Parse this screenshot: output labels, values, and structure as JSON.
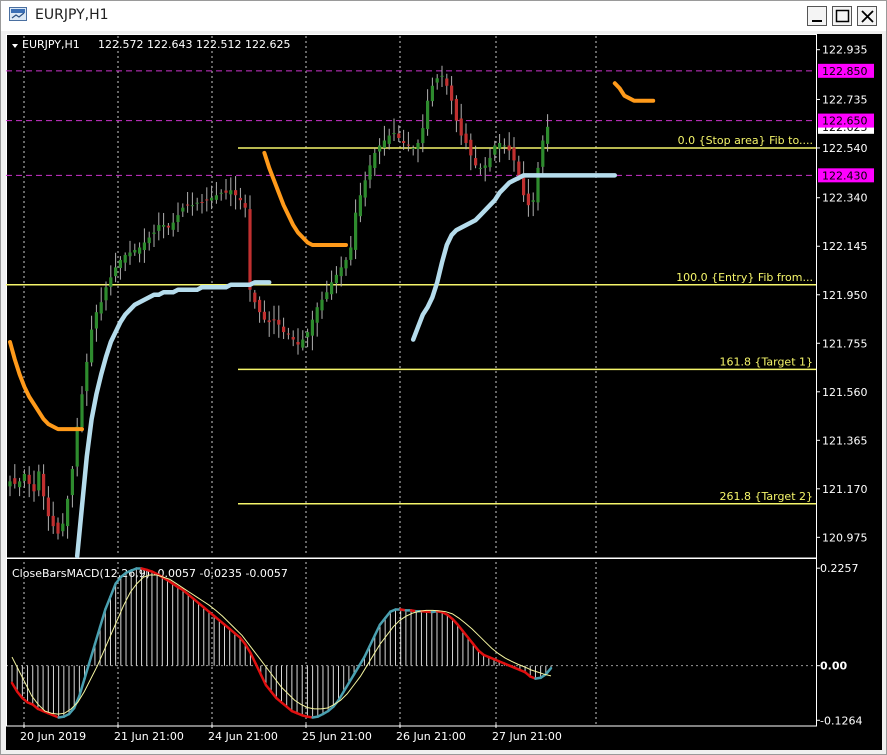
{
  "window": {
    "title": "EURJPY,H1",
    "controls": [
      "minimize",
      "maximize",
      "close"
    ]
  },
  "chart_header": {
    "symbol": "EURJPY,H1",
    "ohlc": "122.572 122.643 122.512 122.625"
  },
  "indicator_header": {
    "label": "CloseBarsMACD(12,26,9) -0.0057 -0.0235 -0.0057"
  },
  "colors": {
    "background": "#000000",
    "grid": "#ffffff",
    "bull_candle": "#2e8b2e",
    "bear_candle": "#c03030",
    "orange_line": "#ff9a1a",
    "lightblue_line": "#b5dcec",
    "fib_line": "#f5f56a",
    "magenta_line": "#cc33cc",
    "price_tag_bg": "#ff00ff",
    "macd_up": "#4aa0b0",
    "macd_down": "#e01010",
    "signal": "#f5f5a0"
  },
  "chart_data": [
    {
      "type": "candlestick",
      "title": "",
      "xlabel": "",
      "ylabel": "",
      "x_tick_labels": [
        "20 Jun 2019",
        "21 Jun 21:00",
        "24 Jun 21:00",
        "25 Jun 21:00",
        "26 Jun 21:00",
        "27 Jun 21:00"
      ],
      "y_tick_labels": [
        "122.935",
        "122.735",
        "122.540",
        "122.340",
        "122.145",
        "121.950",
        "121.755",
        "121.560",
        "121.365",
        "121.170",
        "120.975"
      ],
      "ylim": [
        120.9,
        122.99
      ],
      "grid": true,
      "price_levels": [
        {
          "label": "122.850",
          "value": 122.85,
          "style": "dashed-magenta"
        },
        {
          "label": "122.650",
          "value": 122.65,
          "style": "dashed-magenta"
        },
        {
          "label": "122.625",
          "value": 122.625,
          "style": "current-price"
        },
        {
          "label": "122.430",
          "value": 122.43,
          "style": "dashed-magenta"
        }
      ],
      "fib_levels": [
        {
          "label": "0.0  {Stop area} Fib to....",
          "value": 122.54,
          "full_width": true
        },
        {
          "label": "100.0 {Entry} Fib from...",
          "value": 121.99,
          "full_width": true
        },
        {
          "label": "161.8  {Target 1}",
          "value": 121.65,
          "full_width": false
        },
        {
          "label": "261.8   {Target  2}",
          "value": 121.11,
          "full_width": false
        }
      ],
      "close_series": [
        121.2,
        121.19,
        121.2,
        121.23,
        121.19,
        121.16,
        121.24,
        121.14,
        121.06,
        121.02,
        120.99,
        121.03,
        121.13,
        121.25,
        121.42,
        121.55,
        121.68,
        121.81,
        121.88,
        121.92,
        121.98,
        122.02,
        122.06,
        122.09,
        122.11,
        122.12,
        122.13,
        122.14,
        122.16,
        122.18,
        122.2,
        122.23,
        122.23,
        122.22,
        122.24,
        122.27,
        122.3,
        122.31,
        122.31,
        122.32,
        122.32,
        122.33,
        122.34,
        122.35,
        122.36,
        122.36,
        122.37,
        122.35,
        122.33,
        122.3,
        121.97,
        121.92,
        121.88,
        121.85,
        121.84,
        121.85,
        121.83,
        121.8,
        121.79,
        121.77,
        121.75,
        121.77,
        121.8,
        121.85,
        121.9,
        121.93,
        121.96,
        122.0,
        122.03,
        122.06,
        122.09,
        122.14,
        122.28,
        122.35,
        122.41,
        122.47,
        122.52,
        122.55,
        122.57,
        122.59,
        122.6,
        122.58,
        122.56,
        122.55,
        122.54,
        122.56,
        122.62,
        122.73,
        122.79,
        122.82,
        122.83,
        122.79,
        122.73,
        122.65,
        122.59,
        122.56,
        122.51,
        122.47,
        122.46,
        122.47,
        122.5,
        122.55,
        122.56,
        122.55,
        122.53,
        122.49,
        122.43,
        122.35,
        122.31,
        122.33,
        122.46,
        122.57,
        122.625
      ],
      "orange_line_segments": [
        {
          "x_index_range": [
            0,
            15
          ],
          "values": [
            121.76,
            121.69,
            121.63,
            121.58,
            121.54,
            121.51,
            121.48,
            121.45,
            121.43,
            121.42,
            121.41,
            121.41,
            121.41,
            121.41,
            121.41,
            121.41
          ]
        },
        {
          "x_index_range": [
            53,
            70
          ],
          "values": [
            122.52,
            122.46,
            122.41,
            122.36,
            122.31,
            122.27,
            122.23,
            122.2,
            122.18,
            122.16,
            122.15,
            122.15,
            122.15,
            122.15,
            122.15,
            122.15,
            122.15,
            122.15
          ]
        },
        {
          "x_index_range": [
            126,
            134
          ],
          "values": [
            122.8,
            122.78,
            122.75,
            122.74,
            122.73,
            122.73,
            122.73,
            122.73,
            122.73
          ]
        }
      ],
      "lightblue_line_segments": [
        {
          "x_index_range": [
            14,
            54
          ],
          "values": [
            120.9,
            121.1,
            121.3,
            121.45,
            121.55,
            121.63,
            121.7,
            121.76,
            121.8,
            121.84,
            121.87,
            121.89,
            121.91,
            121.92,
            121.93,
            121.94,
            121.95,
            121.95,
            121.96,
            121.96,
            121.96,
            121.97,
            121.97,
            121.97,
            121.97,
            121.97,
            121.98,
            121.98,
            121.98,
            121.98,
            121.98,
            121.98,
            121.99,
            121.99,
            121.99,
            121.99,
            121.99,
            122.0,
            122.0,
            122.0,
            122.0
          ]
        },
        {
          "x_index_range": [
            84,
            126
          ],
          "values": [
            121.77,
            121.82,
            121.87,
            121.9,
            121.94,
            122.0,
            122.08,
            122.15,
            122.19,
            122.21,
            122.22,
            122.23,
            122.24,
            122.25,
            122.27,
            122.29,
            122.31,
            122.33,
            122.36,
            122.38,
            122.4,
            122.41,
            122.42,
            122.43,
            122.43,
            122.43,
            122.43,
            122.43,
            122.43,
            122.43,
            122.43,
            122.43,
            122.43,
            122.43,
            122.43,
            122.43,
            122.43,
            122.43,
            122.43,
            122.43,
            122.43,
            122.43,
            122.43
          ]
        }
      ]
    },
    {
      "type": "histogram_line",
      "title": "CloseBarsMACD(12,26,9) -0.0057 -0.0235 -0.0057",
      "y_tick_labels": [
        "0.2257",
        "0.00",
        "-0.1264"
      ],
      "ylim": [
        -0.135,
        0.24
      ],
      "zero_label": "0.00",
      "macd_series": [
        -0.04,
        -0.06,
        -0.075,
        -0.085,
        -0.09,
        -0.1,
        -0.105,
        -0.11,
        -0.115,
        -0.12,
        -0.118,
        -0.112,
        -0.098,
        -0.07,
        -0.03,
        0.01,
        0.05,
        0.09,
        0.13,
        0.16,
        0.19,
        0.205,
        0.215,
        0.22,
        0.225,
        0.225,
        0.222,
        0.218,
        0.212,
        0.205,
        0.198,
        0.19,
        0.182,
        0.175,
        0.165,
        0.155,
        0.145,
        0.135,
        0.125,
        0.115,
        0.105,
        0.095,
        0.085,
        0.075,
        0.065,
        0.05,
        0.03,
        0.005,
        -0.02,
        -0.045,
        -0.06,
        -0.075,
        -0.085,
        -0.095,
        -0.105,
        -0.11,
        -0.115,
        -0.118,
        -0.12,
        -0.118,
        -0.112,
        -0.105,
        -0.095,
        -0.08,
        -0.06,
        -0.04,
        -0.02,
        0.0,
        0.02,
        0.045,
        0.07,
        0.095,
        0.11,
        0.125,
        0.13,
        0.13,
        0.128,
        0.128,
        0.126,
        0.126,
        0.125,
        0.124,
        0.126,
        0.124,
        0.118,
        0.108,
        0.095,
        0.08,
        0.065,
        0.05,
        0.035,
        0.025,
        0.02,
        0.015,
        0.01,
        0.005,
        0.0,
        -0.005,
        -0.01,
        -0.015,
        -0.025,
        -0.03,
        -0.028,
        -0.02,
        -0.0057
      ],
      "signal_series": [
        0.02,
        -0.01,
        -0.04,
        -0.07,
        -0.09,
        -0.105,
        -0.11,
        -0.112,
        -0.11,
        -0.1,
        -0.085,
        -0.06,
        -0.03,
        0.0,
        0.035,
        0.07,
        0.105,
        0.14,
        0.17,
        0.19,
        0.205,
        0.21,
        0.21,
        0.205,
        0.2,
        0.19,
        0.18,
        0.17,
        0.16,
        0.15,
        0.14,
        0.128,
        0.115,
        0.1,
        0.085,
        0.07,
        0.05,
        0.03,
        0.01,
        -0.01,
        -0.03,
        -0.05,
        -0.065,
        -0.08,
        -0.09,
        -0.097,
        -0.1,
        -0.1,
        -0.098,
        -0.09,
        -0.08,
        -0.065,
        -0.045,
        -0.025,
        0.0,
        0.025,
        0.05,
        0.07,
        0.09,
        0.105,
        0.115,
        0.122,
        0.126,
        0.128,
        0.128,
        0.127,
        0.125,
        0.12,
        0.11,
        0.098,
        0.085,
        0.07,
        0.055,
        0.04,
        0.028,
        0.018,
        0.01,
        0.003,
        -0.003,
        -0.01,
        -0.015,
        -0.02,
        -0.0235
      ]
    }
  ]
}
